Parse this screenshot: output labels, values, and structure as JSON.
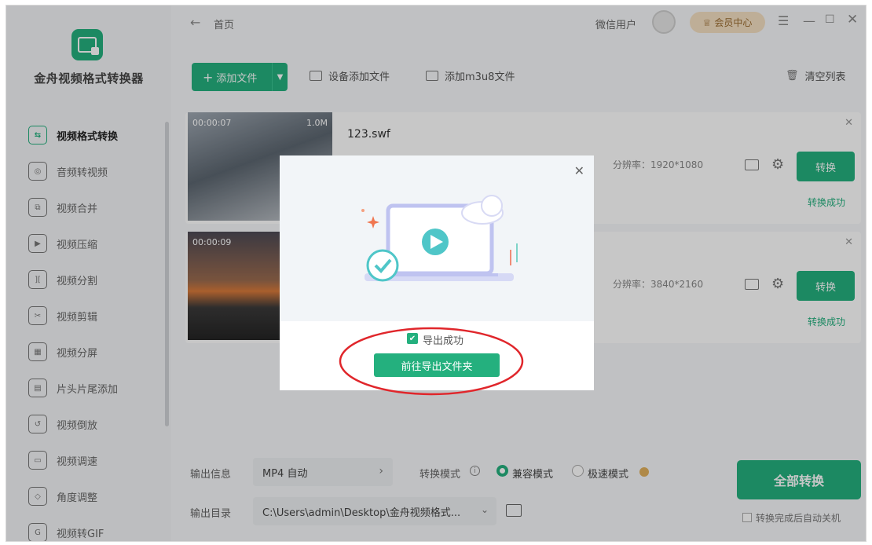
{
  "app": {
    "name": "金舟视频格式转换器"
  },
  "sidebar": {
    "items": [
      {
        "label": "视频格式转换",
        "icon": "convert-icon",
        "active": true
      },
      {
        "label": "音频转视频",
        "icon": "audio-icon"
      },
      {
        "label": "视频合并",
        "icon": "merge-icon"
      },
      {
        "label": "视频压缩",
        "icon": "compress-icon"
      },
      {
        "label": "视频分割",
        "icon": "split-icon"
      },
      {
        "label": "视频剪辑",
        "icon": "scissors-icon"
      },
      {
        "label": "视频分屏",
        "icon": "split-screen-icon"
      },
      {
        "label": "片头片尾添加",
        "icon": "film-icon"
      },
      {
        "label": "视频倒放",
        "icon": "rewind-icon"
      },
      {
        "label": "视频调速",
        "icon": "speed-icon"
      },
      {
        "label": "角度调整",
        "icon": "rotate-icon"
      },
      {
        "label": "视频转GIF",
        "icon": "gif-icon"
      }
    ]
  },
  "topbar": {
    "crumb": "首页",
    "user": "微信用户",
    "vip": "会员中心"
  },
  "toolbar": {
    "add_file": "添加文件",
    "device_add": "设备添加文件",
    "m3u8_add": "添加m3u8文件",
    "clear_list": "清空列表"
  },
  "files": [
    {
      "name": "123.swf",
      "duration": "00:00:07",
      "size": "1.0M",
      "resolution": "分辨率：1920*1080",
      "button": "转换",
      "status": "转换成功"
    },
    {
      "name": "",
      "duration": "00:00:09",
      "size": "",
      "resolution": "分辨率：3840*2160",
      "button": "转换",
      "status": "转换成功"
    }
  ],
  "bottom": {
    "output_info_label": "输出信息",
    "format_value": "MP4 自动",
    "mode_label": "转换模式",
    "mode_compatible": "兼容模式",
    "mode_fast": "极速模式",
    "output_dir_label": "输出目录",
    "output_dir_value": "C:\\Users\\admin\\Desktop\\金舟视频格式...",
    "convert_all": "全部转换",
    "auto_shutdown": "转换完成后自动关机"
  },
  "dialog": {
    "status": "导出成功",
    "open_folder": "前往导出文件夹"
  },
  "colors": {
    "accent": "#24b07e",
    "vip": "#f4dfc2",
    "highlight": "#e0262b"
  }
}
